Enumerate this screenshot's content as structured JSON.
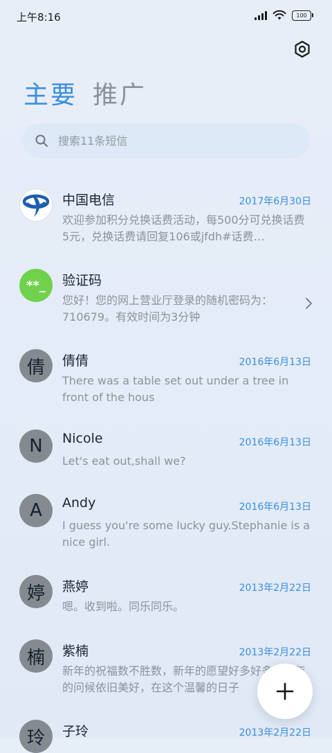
{
  "status_bar": {
    "time": "上午8:16",
    "battery": "100",
    "icons": [
      "signal-icon",
      "wifi-icon",
      "battery-icon"
    ]
  },
  "header": {
    "settings_icon": "settings-icon"
  },
  "tabs": [
    {
      "label": "主要",
      "active": true
    },
    {
      "label": "推广",
      "active": false
    }
  ],
  "search": {
    "placeholder": "搜索11条短信",
    "icon": "search-icon"
  },
  "conversations": [
    {
      "avatar": "",
      "avatar_type": "telecom-logo",
      "name": "中国电信",
      "date": "2017年6月30日",
      "preview": "欢迎参加积分兑换话费活动，每500分可兑换话费5元，兑换话费请回复106或jfdh#话费…"
    },
    {
      "avatar": "**_",
      "avatar_type": "green",
      "name": "验证码",
      "date": "",
      "preview": "您好！您的网上营业厅登录的随机密码为：710679。有效时间为3分钟"
    },
    {
      "avatar": "倩",
      "avatar_type": "letter",
      "name": "倩倩",
      "date": "2016年6月13日",
      "preview": "There was a table set out under a tree in front of the hous"
    },
    {
      "avatar": "N",
      "avatar_type": "letter",
      "name": "Nicole",
      "date": "2016年6月13日",
      "preview": "Let's eat out,shall we?"
    },
    {
      "avatar": "A",
      "avatar_type": "letter",
      "name": "Andy",
      "date": "2016年6月13日",
      "preview": "I guess you're some lucky guy.Stephanie is a nice girl."
    },
    {
      "avatar": "婷",
      "avatar_type": "letter",
      "name": "燕婷",
      "date": "2013年2月22日",
      "preview": "嗯。收到啦。同乐同乐。"
    },
    {
      "avatar": "楠",
      "avatar_type": "letter",
      "name": "紫楠",
      "date": "2013年2月22日",
      "preview": "新年的祝福数不胜数，新年的愿望好多好多，新年的问候依旧美好，在这个温馨的日子"
    },
    {
      "avatar": "玲",
      "avatar_type": "letter",
      "name": "子玲",
      "date": "2013年2月22日",
      "preview": ""
    }
  ],
  "fab": {
    "icon": "plus-icon"
  },
  "colors": {
    "accent": "#3b8ee0",
    "avatar_gray": "#858a91",
    "avatar_green": "#6fd14c",
    "telecom_blue": "#1c5fb0"
  }
}
